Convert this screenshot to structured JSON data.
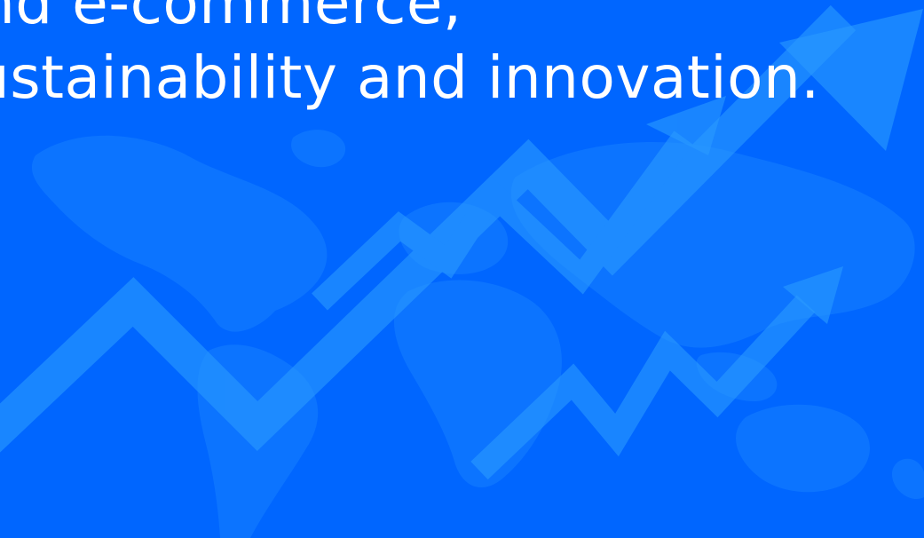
{
  "colors": {
    "background": "#0066ff",
    "text": "#ffffff",
    "map": "#1b86ff",
    "arrow": "#2a9bff"
  },
  "hero": {
    "headline_lines": [
      "and e-commerce,",
      "sustainability and innovation."
    ]
  },
  "decorations": {
    "world_map": "world-map-silhouette",
    "arrows": [
      "trend-arrow-up",
      "trend-arrow-up",
      "trend-arrow-up"
    ]
  }
}
